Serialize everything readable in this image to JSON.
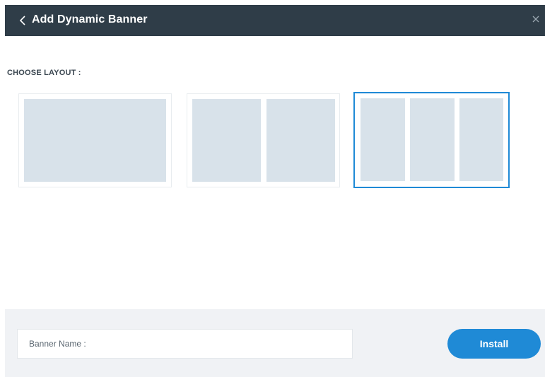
{
  "header": {
    "title": "Add Dynamic Banner",
    "back_icon": "chevron-left-icon",
    "close_icon": "close-icon",
    "background_color": "#2f3d48"
  },
  "layout_picker": {
    "label": "CHOOSE LAYOUT :",
    "options": [
      {
        "id": "one-column",
        "columns": 1,
        "selected": false
      },
      {
        "id": "two-column",
        "columns": 2,
        "selected": false
      },
      {
        "id": "three-column",
        "columns": 3,
        "selected": true
      }
    ],
    "selected_border_color": "#1f8ad6",
    "panel_color": "#d8e2ea"
  },
  "footer": {
    "banner_name_placeholder": "Banner Name :",
    "banner_name_value": "",
    "install_label": "Install",
    "accent_color": "#1f8ad6"
  }
}
